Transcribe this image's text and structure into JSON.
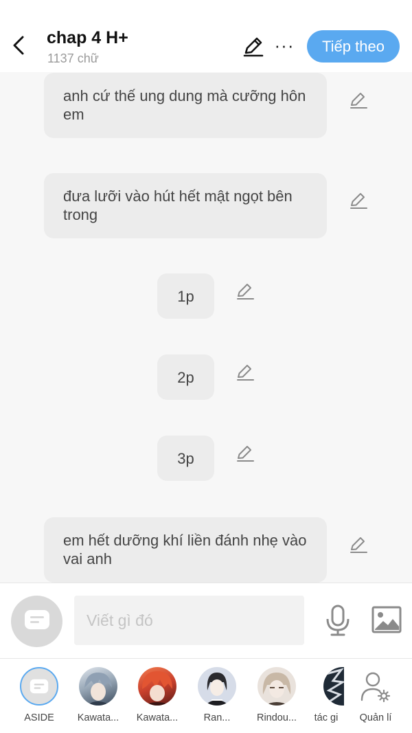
{
  "header": {
    "title": "chap 4 H+",
    "word_count": "1137 chữ",
    "next_label": "Tiếp theo",
    "more_label": "···"
  },
  "messages": [
    {
      "text": "anh cứ thế ung dung mà cưỡng hôn em"
    },
    {
      "text": "đưa lưỡi vào hút hết mật ngọt bên trong"
    },
    {
      "text": "1p"
    },
    {
      "text": "2p"
    },
    {
      "text": "3p"
    },
    {
      "text": "em hết dưỡng khí liền đánh nhẹ vào vai anh"
    }
  ],
  "composer": {
    "placeholder": "Viết gì đó"
  },
  "characters": [
    {
      "label": "ASIDE"
    },
    {
      "label": "Kawata..."
    },
    {
      "label": "Kawata..."
    },
    {
      "label": "Ran..."
    },
    {
      "label": "Rindou..."
    },
    {
      "label": "tác gi"
    },
    {
      "label": "Quản lí"
    }
  ],
  "colors": {
    "accent": "#5aa9f0",
    "bubble": "#ececec",
    "background": "#f7f7f7"
  },
  "icons": [
    "back-arrow-icon",
    "pencil-icon",
    "more-icon",
    "message-icon",
    "microphone-icon",
    "image-icon",
    "user-settings-icon"
  ]
}
